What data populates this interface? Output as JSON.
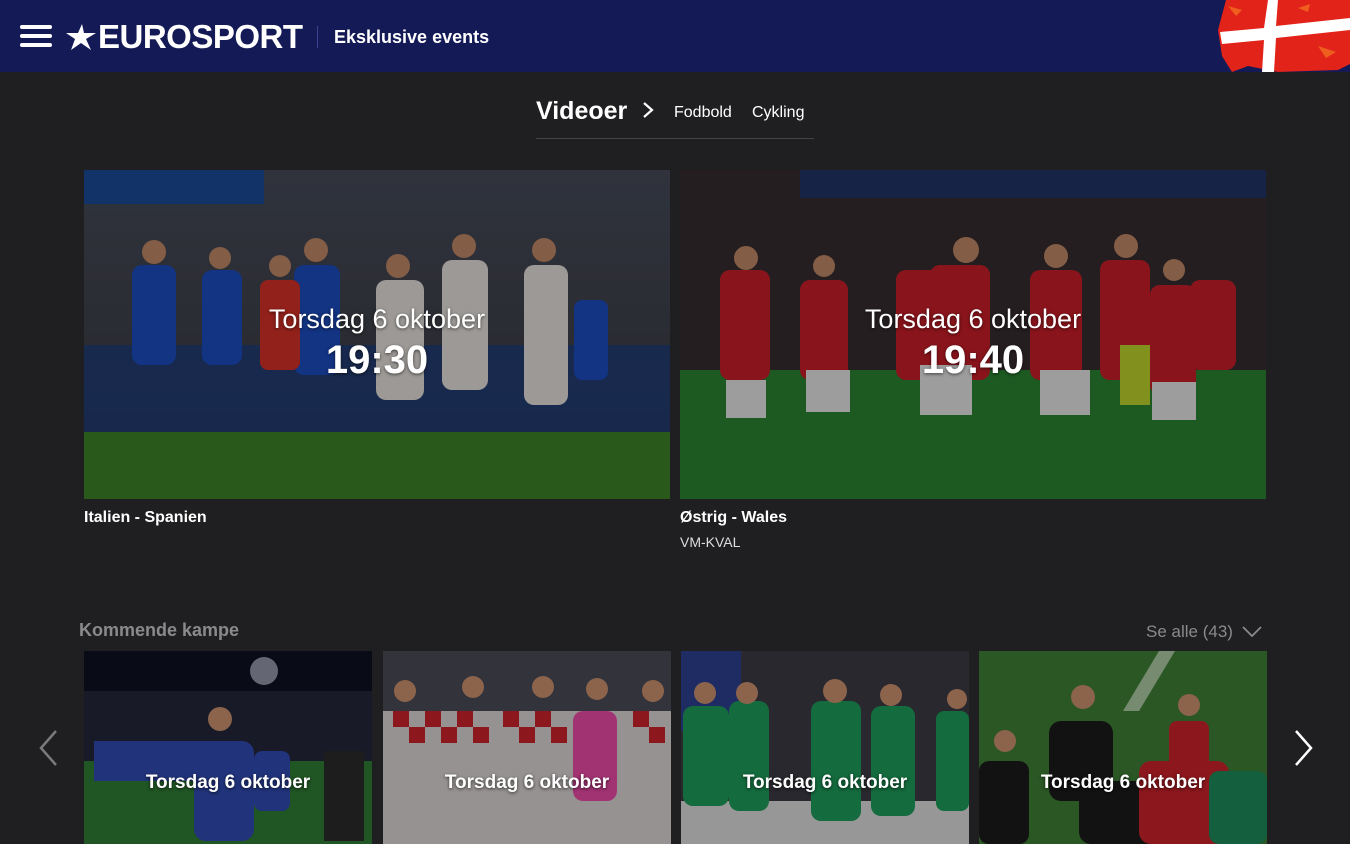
{
  "header": {
    "logo_text": "EUROSPORT",
    "title": "Eksklusive events",
    "flag": "danish-flag"
  },
  "breadcrumb": {
    "main": "Videoer",
    "links": [
      "Fodbold",
      "Cykling"
    ]
  },
  "featured": [
    {
      "date": "Torsdag 6 oktober",
      "time": "19:30",
      "title": "Italien - Spanien",
      "subtitle": ""
    },
    {
      "date": "Torsdag 6 oktober",
      "time": "19:40",
      "title": "Østrig - Wales",
      "subtitle": "VM-KVAL"
    }
  ],
  "upcoming": {
    "title": "Kommende kampe",
    "see_all": "Se alle (43)",
    "cards": [
      {
        "date": "Torsdag 6 oktober"
      },
      {
        "date": "Torsdag 6 oktober"
      },
      {
        "date": "Torsdag 6 oktober"
      },
      {
        "date": "Torsdag 6 oktober"
      }
    ]
  },
  "colors": {
    "header_bg": "#141a56",
    "page_bg": "#1f1f21",
    "muted_text": "#8a8a8d"
  },
  "icons": [
    "menu-icon",
    "chevron-right-icon",
    "chevron-down-icon",
    "arrow-left-icon",
    "arrow-right-icon"
  ]
}
